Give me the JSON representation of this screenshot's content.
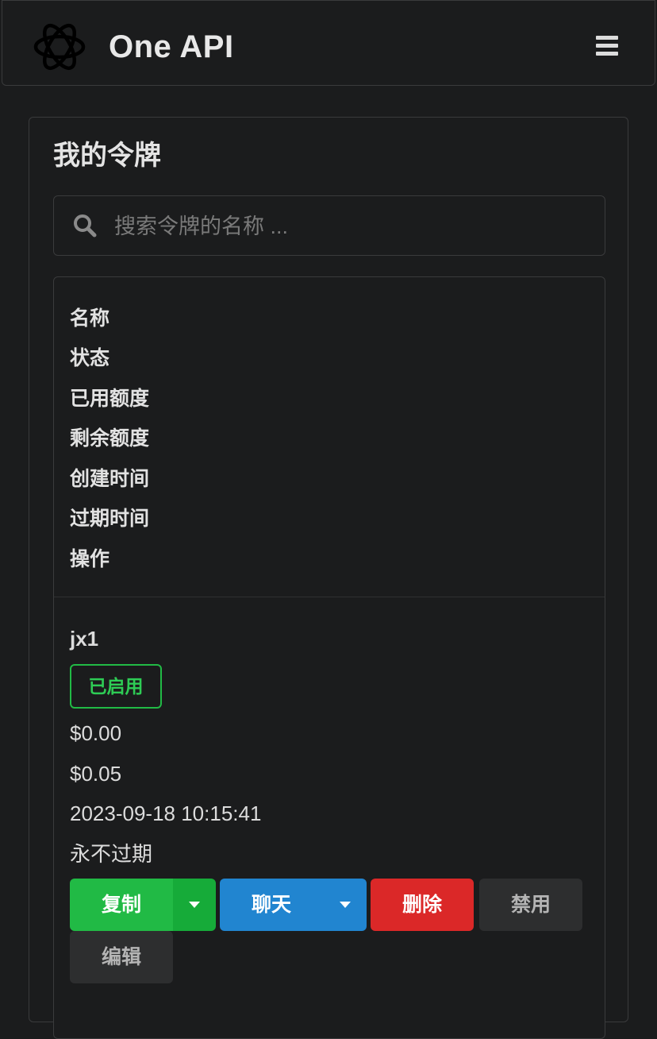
{
  "header": {
    "app_title": "One API",
    "logo_icon": "openai-logo-icon",
    "menu_icon": "hamburger-menu-icon"
  },
  "page": {
    "title": "我的令牌"
  },
  "search": {
    "placeholder": "搜索令牌的名称 ...",
    "value": "",
    "icon": "search-icon"
  },
  "table": {
    "headers": [
      "名称",
      "状态",
      "已用额度",
      "剩余额度",
      "创建时间",
      "过期时间",
      "操作"
    ],
    "rows": [
      {
        "name": "jx1",
        "status": "已启用",
        "used_quota": "$0.00",
        "remaining_quota": "$0.05",
        "created_time": "2023-09-18 10:15:41",
        "expire_time": "永不过期",
        "actions": {
          "copy": "复制",
          "chat": "聊天",
          "delete": "删除",
          "disable": "禁用",
          "edit": "编辑"
        }
      }
    ]
  },
  "colors": {
    "background": "#1b1c1d",
    "border": "#3a3b3c",
    "status_enabled": "#21ba45",
    "copy_button": "#21ba45",
    "chat_button": "#2185d0",
    "delete_button": "#db2828",
    "neutral_button": "#2d2e2f"
  }
}
